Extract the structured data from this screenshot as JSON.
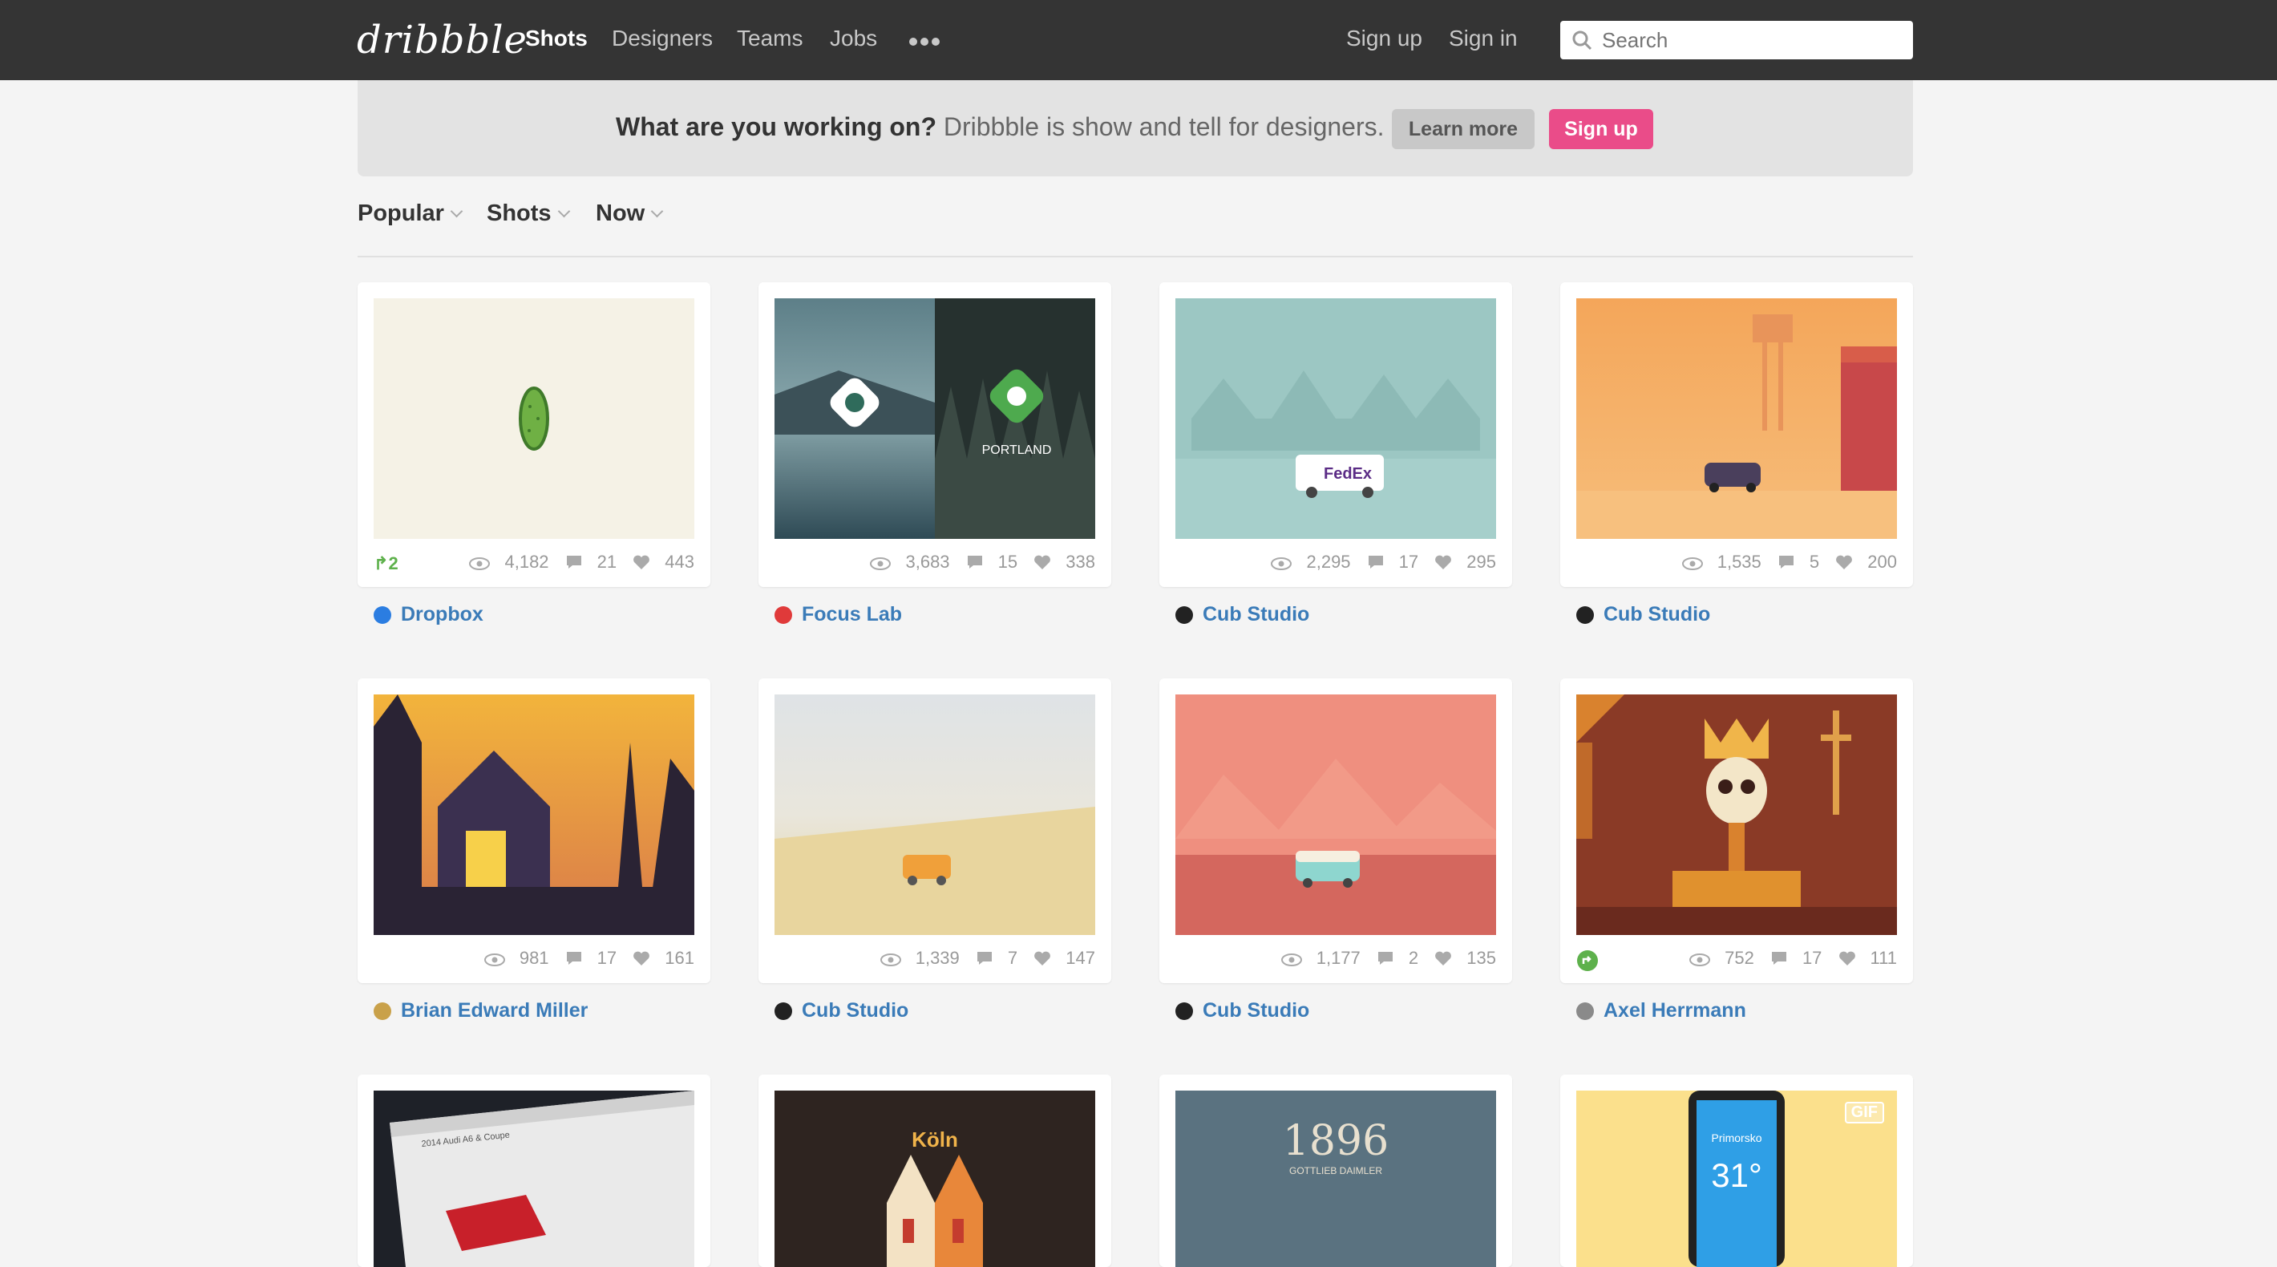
{
  "header": {
    "logo": "dribbble",
    "nav": [
      "Shots",
      "Designers",
      "Teams",
      "Jobs"
    ],
    "more_icon": "more-dots-icon",
    "signup": "Sign up",
    "signin": "Sign in",
    "search_placeholder": "Search"
  },
  "banner": {
    "question": "What are you working on?",
    "text": " Dribbble is show and tell for designers.",
    "learn_more": "Learn more",
    "sign_up": "Sign up"
  },
  "filters": [
    "Popular",
    "Shots",
    "Now"
  ],
  "colors": {
    "topbar": "#343434",
    "pink": "#ea4c89",
    "link": "#3a7bb8",
    "rebound": "#5eb14c"
  },
  "shots": [
    {
      "views": "4,182",
      "comments": "21",
      "likes": "443",
      "rebounds": "2",
      "author": "Dropbox"
    },
    {
      "views": "3,683",
      "comments": "15",
      "likes": "338",
      "author": "Focus Lab",
      "overlay_text": "PORTLAND"
    },
    {
      "views": "2,295",
      "comments": "17",
      "likes": "295",
      "author": "Cub Studio",
      "overlay_text": "FedEx"
    },
    {
      "views": "1,535",
      "comments": "5",
      "likes": "200",
      "author": "Cub Studio"
    },
    {
      "views": "981",
      "comments": "17",
      "likes": "161",
      "author": "Brian Edward Miller"
    },
    {
      "views": "1,339",
      "comments": "7",
      "likes": "147",
      "author": "Cub Studio"
    },
    {
      "views": "1,177",
      "comments": "2",
      "likes": "135",
      "author": "Cub Studio"
    },
    {
      "views": "752",
      "comments": "17",
      "likes": "111",
      "author": "Axel Herrmann"
    },
    {
      "overlay_text": "2014 Audi A6 & Coupe"
    },
    {
      "overlay_text": "Köln"
    },
    {
      "overlay_text": "1896",
      "overlay_sub": "GOTTLIEB DAIMLER"
    },
    {
      "badge": "GIF",
      "city": "Primorsko",
      "temp": "31°"
    }
  ]
}
